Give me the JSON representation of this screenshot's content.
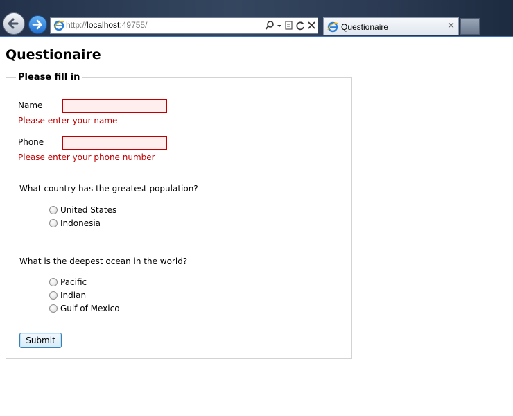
{
  "browser": {
    "url_prefix": "http://",
    "url_host": "localhost",
    "url_suffix": ":49755/",
    "tab_title": "Questionaire",
    "tab_close": "✕",
    "toolbar_icons": [
      "search-icon",
      "dropdown-arrow-icon",
      "compatibility-view-icon",
      "refresh-icon",
      "stop-icon"
    ],
    "back_icon": "back-arrow-icon",
    "forward_icon": "forward-arrow-icon"
  },
  "page": {
    "title": "Questionaire"
  },
  "form": {
    "legend": "Please fill in",
    "name_label": "Name",
    "name_value": "",
    "name_error": "Please enter your name",
    "phone_label": "Phone",
    "phone_value": "",
    "phone_error": "Please enter your phone number",
    "q1": {
      "text": "What country has the greatest population?",
      "options": [
        "United States",
        "Indonesia"
      ]
    },
    "q2": {
      "text": "What is the deepest ocean in the world?",
      "options": [
        "Pacific",
        "Indian",
        "Gulf of Mexico"
      ]
    },
    "submit_label": "Submit"
  },
  "colors": {
    "error": "#c00000",
    "invalid_field_bg": "#ffeeee",
    "chrome_accent": "#3f74b8"
  }
}
